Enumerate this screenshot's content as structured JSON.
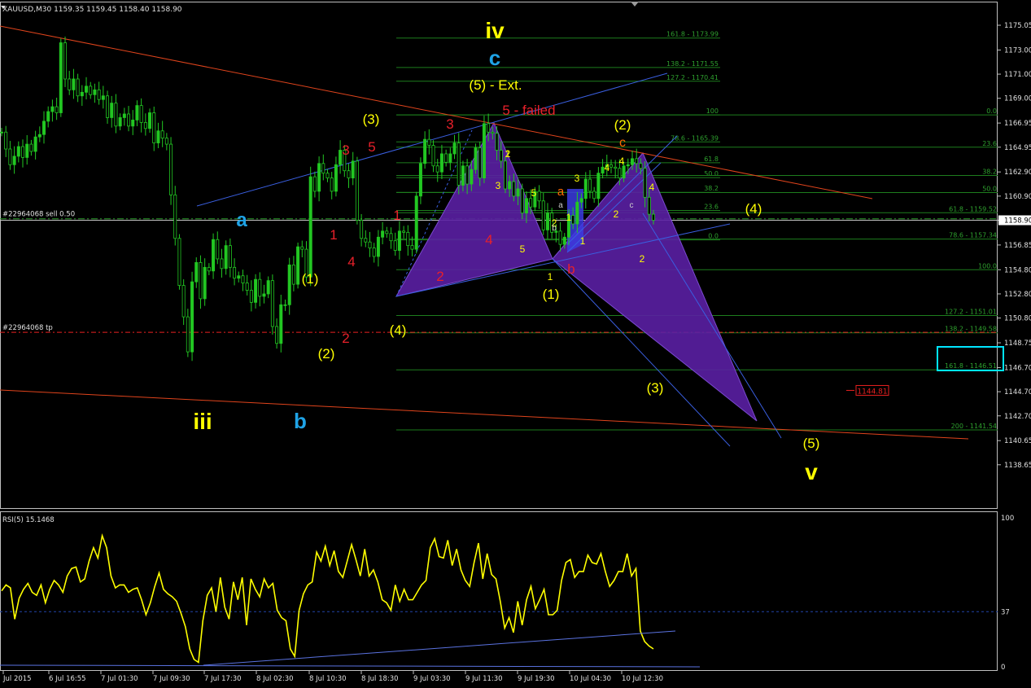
{
  "chart_data": {
    "type": "candlestick",
    "symbol_header": "XAUUSD,M30  1159.35 1159.45 1158.40 1158.90",
    "ylim": [
      1137.6,
      1176.4
    ],
    "price_ticks": [
      "1175.05",
      "1173.00",
      "1171.00",
      "1169.00",
      "1166.95",
      "1164.95",
      "1162.90",
      "1160.90",
      "1158.90",
      "1156.85",
      "1154.80",
      "1152.80",
      "1150.80",
      "1148.75",
      "1146.70",
      "1144.70",
      "1142.70",
      "1140.65",
      "1138.65"
    ],
    "current_price": "1158.90",
    "time_ticks": [
      "Jul 2015",
      "6 Jul 16:55",
      "7 Jul 01:30",
      "7 Jul 09:30",
      "7 Jul 17:30",
      "8 Jul 02:30",
      "8 Jul 10:30",
      "8 Jul 18:30",
      "9 Jul 03:30",
      "9 Jul 11:30",
      "9 Jul 19:30",
      "10 Jul 04:30",
      "10 Jul 12:30"
    ],
    "order_labels": {
      "sell": "#22964068 sell 0.50",
      "tp": "#22964068 tp"
    },
    "price_tag": "1144.81",
    "fib_levels_left": [
      {
        "label": "161.8 - 1173.99",
        "price": 1173.99
      },
      {
        "label": "138.2 - 1171.55",
        "price": 1171.55
      },
      {
        "label": "127.2 - 1170.41",
        "price": 1170.41
      },
      {
        "label": "100",
        "price": 1167.62
      },
      {
        "label": "78.6 - 1165.39",
        "price": 1165.39
      },
      {
        "label": "61.8",
        "price": 1163.66
      },
      {
        "label": "50.0",
        "price": 1162.43
      },
      {
        "label": "38.2",
        "price": 1161.21
      },
      {
        "label": "23.6",
        "price": 1159.71
      },
      {
        "label": "0.0",
        "price": 1157.27
      }
    ],
    "fib_levels_right": [
      {
        "label": "0.0",
        "price": 1167.62
      },
      {
        "label": "23.6",
        "price": 1164.95
      },
      {
        "label": "38.2",
        "price": 1162.61
      },
      {
        "label": "50.0",
        "price": 1161.19
      },
      {
        "label": "61.8 - 1159.52",
        "price": 1159.52
      },
      {
        "label": "78.6 - 1157.34",
        "price": 1157.34
      },
      {
        "label": "100.0",
        "price": 1154.8
      },
      {
        "label": "127.2 - 1151.01",
        "price": 1151.01
      },
      {
        "label": "138.2 - 1149.58",
        "price": 1149.58
      },
      {
        "label": "161.8 - 1146.51",
        "price": 1146.51
      },
      {
        "label": "200 - 1141.54",
        "price": 1141.54
      }
    ],
    "wave_labels": [
      {
        "text": "iv",
        "color": "#ffff00",
        "size": 28
      },
      {
        "text": "c",
        "color": "#1fa3e6",
        "size": 26
      },
      {
        "text": "(5) - Ext.",
        "color": "#ffff00",
        "size": 17
      },
      {
        "text": "5 - failed",
        "color": "#e8202a",
        "size": 17
      },
      {
        "text": "(3)",
        "color": "#ffff00",
        "size": 17
      },
      {
        "text": "3",
        "color": "#e8202a",
        "size": 17
      },
      {
        "text": "5",
        "color": "#e8202a",
        "size": 17
      },
      {
        "text": "3",
        "color": "#e8202a",
        "size": 17
      },
      {
        "text": "(2)",
        "color": "#ffff00",
        "size": 17
      },
      {
        "text": "c",
        "color": "#ff6a00",
        "size": 16
      },
      {
        "text": "a",
        "color": "#1fa3e6",
        "size": 24
      },
      {
        "text": "1",
        "color": "#e8202a",
        "size": 17
      },
      {
        "text": "1",
        "color": "#e8202a",
        "size": 17
      },
      {
        "text": "4",
        "color": "#e8202a",
        "size": 17
      },
      {
        "text": "4",
        "color": "#e8202a",
        "size": 17
      },
      {
        "text": "2",
        "color": "#e8202a",
        "size": 17
      },
      {
        "text": "2",
        "color": "#e8202a",
        "size": 17
      },
      {
        "text": "(1)",
        "color": "#ffff00",
        "size": 17
      },
      {
        "text": "(2)",
        "color": "#ffff00",
        "size": 17
      },
      {
        "text": "(4)",
        "color": "#ffff00",
        "size": 17
      },
      {
        "text": "(1)",
        "color": "#ffff00",
        "size": 17
      },
      {
        "text": "(4)",
        "color": "#ffff00",
        "size": 17
      },
      {
        "text": "(3)",
        "color": "#ffff00",
        "size": 17
      },
      {
        "text": "(5)",
        "color": "#ffff00",
        "size": 17
      },
      {
        "text": "v",
        "color": "#ffff00",
        "size": 28
      },
      {
        "text": "iii",
        "color": "#ffff00",
        "size": 28
      },
      {
        "text": "b",
        "color": "#1fa3e6",
        "size": 26
      },
      {
        "text": "a",
        "color": "#ff6a00",
        "size": 15
      },
      {
        "text": "b",
        "color": "#e8202a",
        "size": 17
      },
      {
        "text": "1",
        "color": "#ffff00",
        "size": 12
      },
      {
        "text": "2",
        "color": "#ffff00",
        "size": 12
      },
      {
        "text": "3",
        "color": "#ffff00",
        "size": 12
      },
      {
        "text": "4",
        "color": "#ffff00",
        "size": 12
      },
      {
        "text": "5",
        "color": "#ffff00",
        "size": 12
      },
      {
        "text": "1",
        "color": "#ffff00",
        "size": 12
      },
      {
        "text": "3",
        "color": "#ffff00",
        "size": 12
      },
      {
        "text": "5",
        "color": "#ffff00",
        "size": 12
      },
      {
        "text": "4",
        "color": "#ffff00",
        "size": 12
      },
      {
        "text": "2",
        "color": "#ffff00",
        "size": 12
      },
      {
        "text": "1",
        "color": "#ffff00",
        "size": 12
      },
      {
        "text": "2",
        "color": "#ffff00",
        "size": 12
      },
      {
        "text": "4",
        "color": "#ffff00",
        "size": 12
      },
      {
        "text": "2",
        "color": "#ffff00",
        "size": 12
      },
      {
        "text": "1",
        "color": "#ffff00",
        "size": 12
      },
      {
        "text": "c",
        "color": "#cccccc",
        "size": 10
      },
      {
        "text": "a",
        "color": "#cccccc",
        "size": 10
      },
      {
        "text": "b",
        "color": "#cccccc",
        "size": 10
      }
    ],
    "close_series": [
      1166.2,
      1164.8,
      1163.5,
      1164.2,
      1165.0,
      1164.1,
      1165.2,
      1164.6,
      1165.8,
      1166.0,
      1167.1,
      1167.9,
      1168.3,
      1167.8,
      1173.6,
      1170.6,
      1169.7,
      1170.6,
      1169.2,
      1169.5,
      1170.0,
      1169.3,
      1169.7,
      1168.9,
      1169.2,
      1167.4,
      1168.6,
      1166.7,
      1167.4,
      1167.7,
      1166.7,
      1167.2,
      1168.4,
      1167.0,
      1166.5,
      1167.8,
      1165.3,
      1166.3,
      1165.7,
      1165.2,
      1161.0,
      1157.4,
      1153.5,
      1150.9,
      1148.0,
      1153.8,
      1155.4,
      1152.4,
      1155.0,
      1154.7,
      1157.3,
      1155.7,
      1154.9,
      1156.8,
      1155.0,
      1154.1,
      1154.3,
      1153.7,
      1153.1,
      1152.1,
      1154.0,
      1152.6,
      1152.8,
      1153.9,
      1150.1,
      1148.7,
      1151.9,
      1151.9,
      1155.2,
      1153.6,
      1156.7,
      1156.5,
      1154.2,
      1162.5,
      1161.3,
      1163.6,
      1162.8,
      1162.4,
      1161.3,
      1163.5,
      1164.7,
      1163.0,
      1162.4,
      1163.8,
      1158.9,
      1157.4,
      1157.1,
      1156.6,
      1155.9,
      1157.5,
      1158.0,
      1157.8,
      1157.2,
      1156.4,
      1158.0,
      1157.9,
      1156.8,
      1156.5,
      1160.9,
      1163.6,
      1165.6,
      1165.1,
      1163.4,
      1162.9,
      1164.4,
      1163.7,
      1164.4,
      1165.3,
      1161.8,
      1163.4,
      1161.9,
      1163.1,
      1164.9,
      1162.4,
      1166.9,
      1166.2,
      1166.1,
      1164.7,
      1163.8,
      1161.5,
      1162.1,
      1160.9,
      1161.5,
      1159.5,
      1160.7,
      1160.0,
      1161.3,
      1160.5,
      1158.1,
      1159.5,
      1157.9,
      1158.0,
      1156.9,
      1157.5,
      1159.3,
      1158.6,
      1160.4,
      1160.7,
      1162.3,
      1161.3,
      1160.7,
      1162.8,
      1163.3,
      1163.5,
      1163.3,
      1163.2,
      1162.4,
      1163.4,
      1163.5,
      1164.0,
      1163.6,
      1163.2,
      1160.8,
      1159.4,
      1158.9
    ],
    "rsi": {
      "label": "RSI(5) 15.1468",
      "ylim": [
        0,
        100
      ],
      "ticks": [
        "100",
        "37",
        "0"
      ],
      "level": 37,
      "values": [
        51,
        55,
        53,
        32,
        46,
        52,
        56,
        50,
        48,
        55,
        43,
        52,
        58,
        55,
        50,
        61,
        66,
        67,
        57,
        59,
        71,
        80,
        73,
        88,
        80,
        61,
        53,
        55,
        55,
        50,
        52,
        53,
        45,
        35,
        43,
        54,
        63,
        52,
        49,
        47,
        44,
        36,
        27,
        12,
        5,
        3,
        31,
        48,
        53,
        37,
        60,
        40,
        32,
        57,
        45,
        60,
        28,
        59,
        52,
        47,
        59,
        53,
        56,
        38,
        33,
        31,
        12,
        7,
        38,
        49,
        55,
        57,
        77,
        71,
        81,
        68,
        78,
        64,
        60,
        71,
        82,
        72,
        61,
        79,
        61,
        65,
        57,
        45,
        43,
        38,
        55,
        44,
        52,
        45,
        45,
        50,
        55,
        58,
        80,
        86,
        74,
        73,
        85,
        68,
        79,
        65,
        58,
        54,
        70,
        83,
        59,
        76,
        62,
        59,
        44,
        26,
        33,
        23,
        44,
        28,
        45,
        54,
        39,
        45,
        52,
        35,
        35,
        38,
        58,
        70,
        72,
        60,
        64,
        64,
        75,
        70,
        69,
        76,
        64,
        54,
        58,
        64,
        64,
        76,
        61,
        66,
        24,
        17,
        14,
        12
      ]
    }
  }
}
